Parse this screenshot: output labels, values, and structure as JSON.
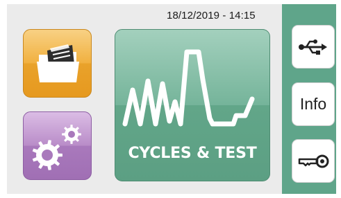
{
  "status_bar": {
    "datetime": "18/12/2019 - 14:15"
  },
  "tiles": {
    "files": {
      "icon": "folder-documents-icon",
      "color": "#f1b03f"
    },
    "settings": {
      "icon": "gears-icon",
      "color": "#b98cc8"
    },
    "cycles_test": {
      "label": "CYCLES & TEST",
      "icon": "waveform-icon",
      "color": "#6aab90"
    }
  },
  "side_panel": {
    "color": "#5fa58a",
    "buttons": [
      {
        "id": "usb",
        "icon": "usb-icon"
      },
      {
        "id": "info",
        "label": "Info"
      },
      {
        "id": "key",
        "icon": "key-icon"
      }
    ]
  }
}
